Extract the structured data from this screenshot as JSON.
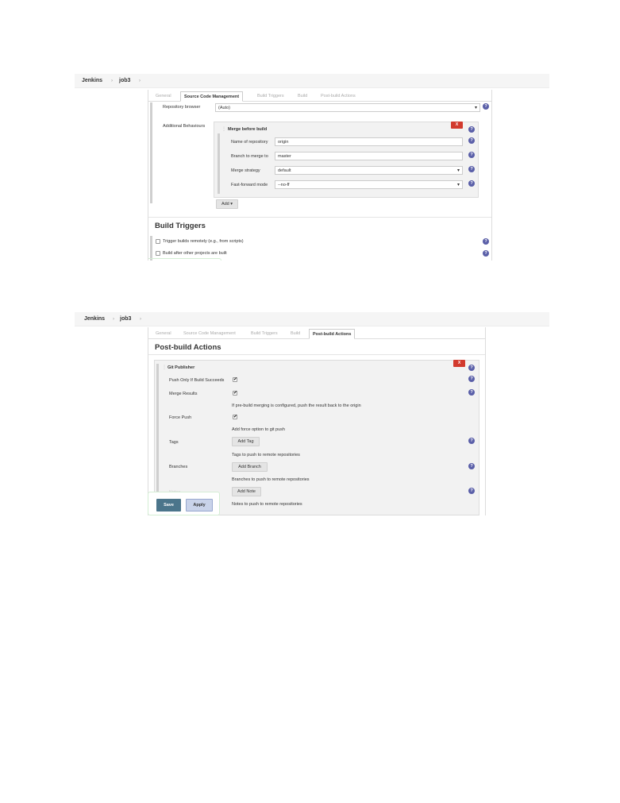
{
  "screenshot1": {
    "breadcrumb": {
      "home": "Jenkins",
      "job": "job3",
      "sep": "›"
    },
    "tabs": [
      "General",
      "Source Code Management",
      "Build Triggers",
      "Build",
      "Post-build Actions"
    ],
    "active_tab": "Source Code Management",
    "repo_browser": {
      "label": "Repository browser",
      "value": "(Auto)"
    },
    "additional_behaviours": {
      "label": "Additional Behaviours",
      "block_title": "Merge before build",
      "close_label": "X",
      "fields": [
        {
          "label": "Name of repository",
          "value": "origin"
        },
        {
          "label": "Branch to merge to",
          "value": "master"
        },
        {
          "label": "Merge strategy",
          "value": "default"
        },
        {
          "label": "Fast-forward mode",
          "value": "--no-ff"
        }
      ],
      "add_label": "Add"
    },
    "build_triggers": {
      "heading": "Build Triggers",
      "items": [
        "Trigger builds remotely (e.g., from scripts)",
        "Build after other projects are built"
      ]
    }
  },
  "screenshot2": {
    "breadcrumb": {
      "home": "Jenkins",
      "job": "job3",
      "sep": "›"
    },
    "tabs": [
      "General",
      "Source Code Management",
      "Build Triggers",
      "Build",
      "Post-build Actions"
    ],
    "active_tab": "Post-build Actions",
    "heading": "Post-build Actions",
    "git_publisher": {
      "title": "Git Publisher",
      "close_label": "X",
      "push_only": "Push Only If Build Succeeds",
      "merge_results": "Merge Results",
      "merge_desc": "If pre-build merging is configured, push the result back to the origin",
      "force_push": "Force Push",
      "force_desc": "Add force option to git push",
      "tags": "Tags",
      "add_tag": "Add Tag",
      "tags_desc": "Tags to push to remote repositories",
      "branches": "Branches",
      "add_branch": "Add Branch",
      "branches_desc": "Branches to push to remote repositories",
      "notes": "Notes",
      "add_note": "Add Note",
      "notes_desc": "Notes to push to remote repositories"
    },
    "save_label": "Save",
    "apply_label": "Apply"
  },
  "colors": {
    "accent": "#4b758b",
    "help": "#5a5fa8",
    "delete": "#d23a2e"
  },
  "icons": [
    "help-icon",
    "chevron-down-icon",
    "checkbox-icon",
    "drag-handle-icon"
  ]
}
